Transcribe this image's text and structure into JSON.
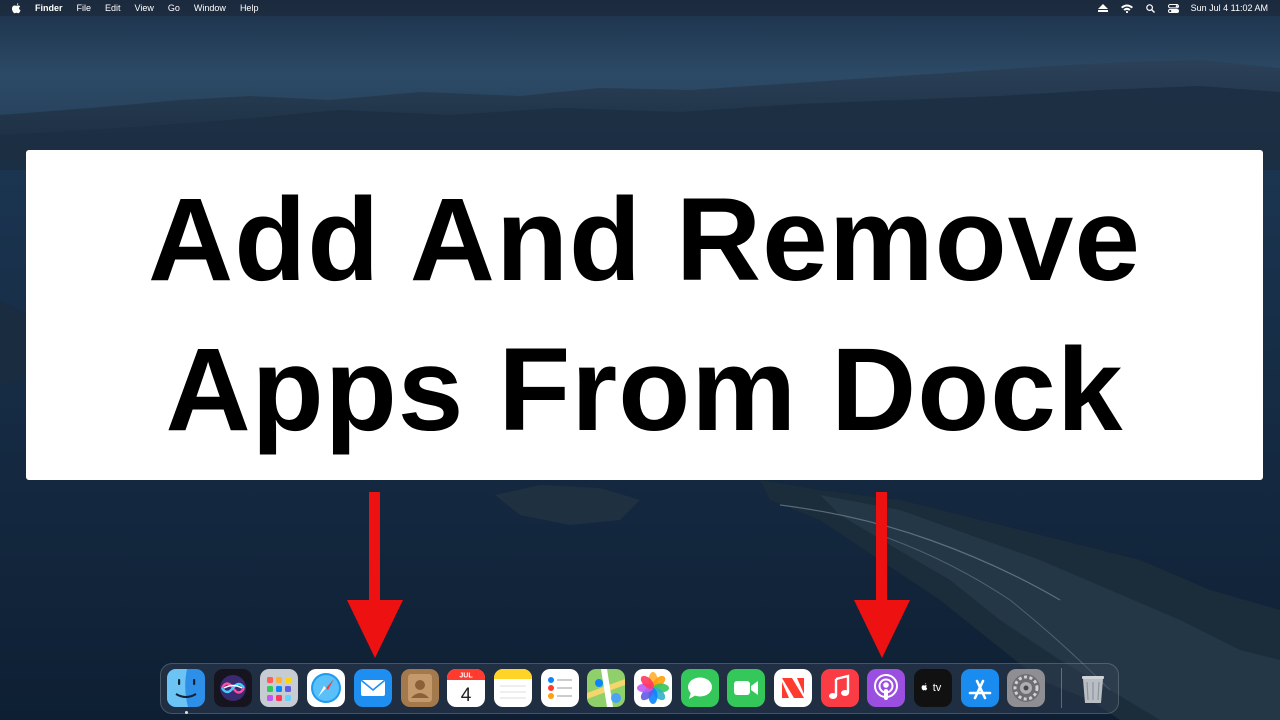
{
  "menubar": {
    "app_name": "Finder",
    "menus": [
      "File",
      "Edit",
      "View",
      "Go",
      "Window",
      "Help"
    ],
    "status_icons": [
      "eject-icon",
      "wifi-icon",
      "spotlight-search-icon",
      "control-center-icon"
    ],
    "clock": "Sun Jul 4  11:02 AM"
  },
  "title": {
    "line1": "Add And Remove",
    "line2": "Apps From Dock"
  },
  "colors": {
    "arrow": "#ee1111",
    "card": "#ffffff",
    "title_text": "#000000"
  },
  "dock": {
    "apps": [
      {
        "name": "Finder",
        "icon": "finder-icon",
        "running": true
      },
      {
        "name": "Siri",
        "icon": "siri-icon"
      },
      {
        "name": "Launchpad",
        "icon": "launchpad-icon"
      },
      {
        "name": "Safari",
        "icon": "safari-icon"
      },
      {
        "name": "Mail",
        "icon": "mail-icon"
      },
      {
        "name": "Contacts",
        "icon": "contacts-icon"
      },
      {
        "name": "Calendar",
        "icon": "calendar-icon",
        "month": "JUL",
        "day": "4"
      },
      {
        "name": "Notes",
        "icon": "notes-icon"
      },
      {
        "name": "Reminders",
        "icon": "reminders-icon"
      },
      {
        "name": "Maps",
        "icon": "maps-icon"
      },
      {
        "name": "Photos",
        "icon": "photos-icon"
      },
      {
        "name": "Messages",
        "icon": "messages-icon"
      },
      {
        "name": "FaceTime",
        "icon": "facetime-icon"
      },
      {
        "name": "News",
        "icon": "news-icon"
      },
      {
        "name": "Music",
        "icon": "music-icon"
      },
      {
        "name": "Podcasts",
        "icon": "podcasts-icon"
      },
      {
        "name": "TV",
        "icon": "apple-tv-icon",
        "label": "tv"
      },
      {
        "name": "App Store",
        "icon": "app-store-icon"
      },
      {
        "name": "System Preferences",
        "icon": "system-preferences-icon"
      },
      {
        "name": "Trash",
        "icon": "trash-icon"
      }
    ]
  }
}
